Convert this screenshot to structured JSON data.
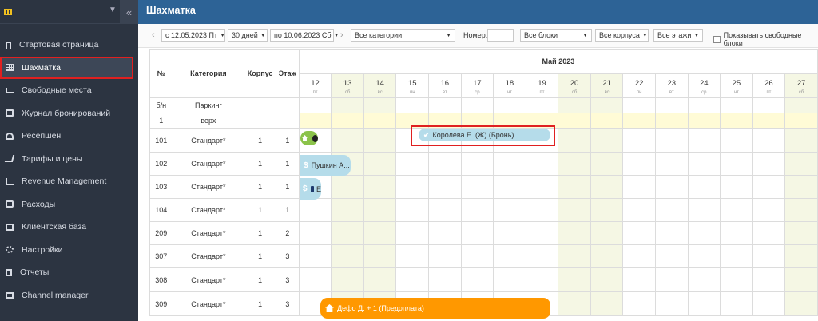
{
  "sidebar": {
    "items": [
      {
        "label": "Стартовая страница",
        "icon": "bookmark-icon"
      },
      {
        "label": "Шахматка",
        "icon": "grid-icon",
        "active": true
      },
      {
        "label": "Свободные места",
        "icon": "bed-icon"
      },
      {
        "label": "Журнал бронирований",
        "icon": "book-icon"
      },
      {
        "label": "Ресепшен",
        "icon": "bell-icon"
      },
      {
        "label": "Тарифы и цены",
        "icon": "cart-icon"
      },
      {
        "label": "Revenue Management",
        "icon": "chart-icon"
      },
      {
        "label": "Расходы",
        "icon": "wallet-icon"
      },
      {
        "label": "Клиентская база",
        "icon": "card-icon"
      },
      {
        "label": "Настройки",
        "icon": "gear-icon"
      },
      {
        "label": "Отчеты",
        "icon": "document-icon"
      },
      {
        "label": "Channel manager",
        "icon": "server-icon"
      }
    ]
  },
  "header": {
    "title": "Шахматка"
  },
  "toolbar": {
    "date_from": "с 12.05.2023 Пт",
    "period": "30 дней",
    "date_to": "по 10.06.2023 Сб",
    "category": "Все категории",
    "number_label": "Номер:",
    "number_value": "",
    "blocks": "Все блоки",
    "buildings": "Все корпуса",
    "floors": "Все этажи",
    "show_free": "Показывать свободные блоки"
  },
  "grid": {
    "headers": {
      "no": "№",
      "category": "Категория",
      "building": "Корпус",
      "floor": "Этаж"
    },
    "month": "Май 2023",
    "days": [
      {
        "d": "12",
        "w": "пт",
        "we": false
      },
      {
        "d": "13",
        "w": "сб",
        "we": true
      },
      {
        "d": "14",
        "w": "вс",
        "we": true
      },
      {
        "d": "15",
        "w": "пн",
        "we": false
      },
      {
        "d": "16",
        "w": "вт",
        "we": false
      },
      {
        "d": "17",
        "w": "ср",
        "we": false
      },
      {
        "d": "18",
        "w": "чт",
        "we": false
      },
      {
        "d": "19",
        "w": "пт",
        "we": false
      },
      {
        "d": "20",
        "w": "сб",
        "we": true
      },
      {
        "d": "21",
        "w": "вс",
        "we": true
      },
      {
        "d": "22",
        "w": "пн",
        "we": false
      },
      {
        "d": "23",
        "w": "вт",
        "we": false
      },
      {
        "d": "24",
        "w": "ср",
        "we": false
      },
      {
        "d": "25",
        "w": "чт",
        "we": false
      },
      {
        "d": "26",
        "w": "пт",
        "we": false
      },
      {
        "d": "27",
        "w": "сб",
        "we": true
      }
    ],
    "rows": [
      {
        "no": "б/н",
        "category": "Паркинг",
        "building": "",
        "floor": "",
        "yellow": false
      },
      {
        "no": "1",
        "category": "верх",
        "building": "",
        "floor": "",
        "yellow": true
      },
      {
        "no": "101",
        "category": "Стандарт*",
        "building": "1",
        "floor": "1",
        "yellow": false
      },
      {
        "no": "102",
        "category": "Стандарт*",
        "building": "1",
        "floor": "1",
        "yellow": false
      },
      {
        "no": "103",
        "category": "Стандарт*",
        "building": "1",
        "floor": "1",
        "yellow": false
      },
      {
        "no": "104",
        "category": "Стандарт*",
        "building": "1",
        "floor": "1",
        "yellow": false
      },
      {
        "no": "209",
        "category": "Стандарт*",
        "building": "1",
        "floor": "2",
        "yellow": false
      },
      {
        "no": "307",
        "category": "Стандарт*",
        "building": "1",
        "floor": "3",
        "yellow": false
      },
      {
        "no": "308",
        "category": "Стандарт*",
        "building": "1",
        "floor": "3",
        "yellow": false
      },
      {
        "no": "309",
        "category": "Стандарт*",
        "building": "1",
        "floor": "3",
        "yellow": false
      }
    ],
    "bookings": {
      "b1": "Королева Е. (Ж) (Бронь)",
      "b2": "Пушкин А...",
      "b3": "Дефо Д. + 1 (Предоплата)",
      "b4": "Е"
    }
  },
  "colors": {
    "header": "#2d6396",
    "sidebar": "#2c3441",
    "weekend": "#f5f7e4",
    "orange": "#ff9800",
    "blue": "#b5dcea",
    "green": "#8bc34a"
  }
}
